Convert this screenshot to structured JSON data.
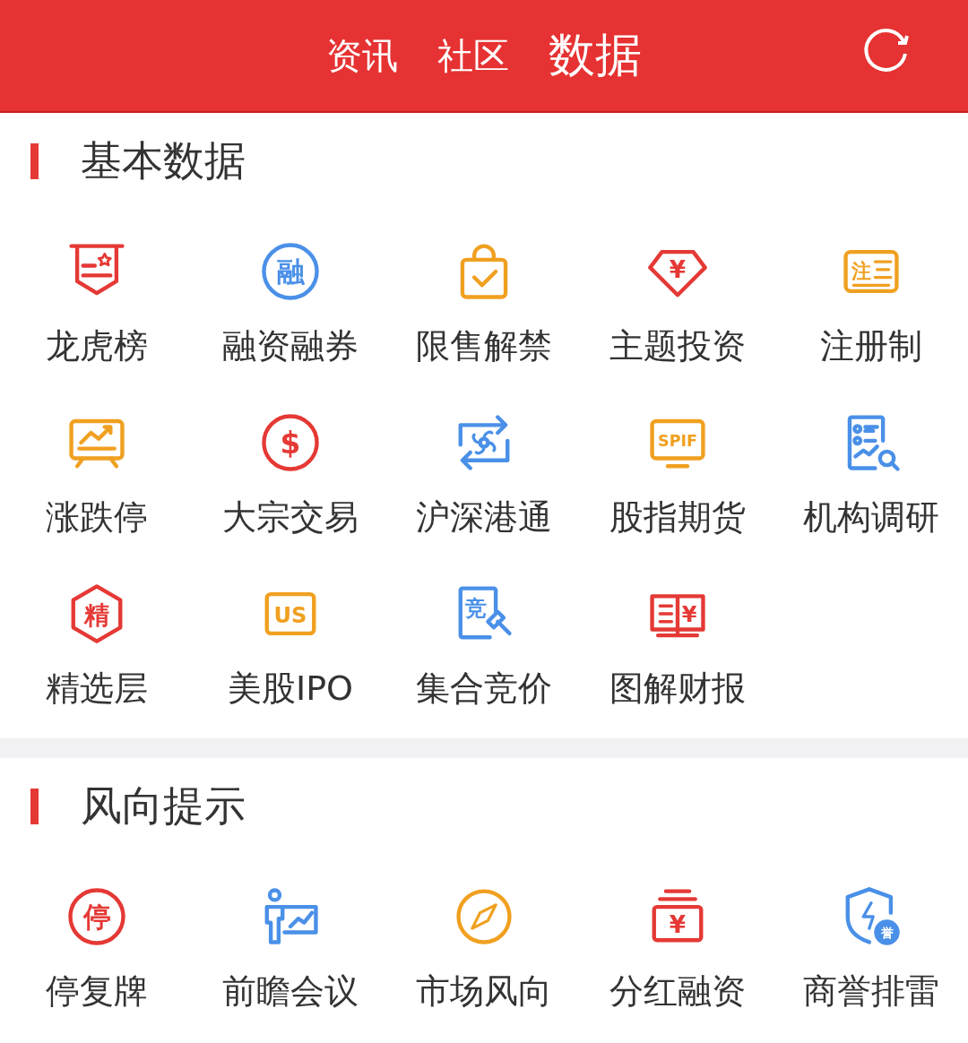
{
  "header": {
    "tabs": [
      {
        "label": "资讯",
        "selected": false
      },
      {
        "label": "社区",
        "selected": false
      },
      {
        "label": "数据",
        "selected": true
      }
    ]
  },
  "sections": [
    {
      "title": "基本数据",
      "items": [
        {
          "label": "龙虎榜",
          "color": "#e53935"
        },
        {
          "label": "融资融券",
          "color": "#4a90e8",
          "glyph": "融"
        },
        {
          "label": "限售解禁",
          "color": "#f0a020"
        },
        {
          "label": "主题投资",
          "color": "#e53935",
          "glyph": "¥"
        },
        {
          "label": "注册制",
          "color": "#f0a020",
          "glyph": "注"
        },
        {
          "label": "涨跌停",
          "color": "#f0a020"
        },
        {
          "label": "大宗交易",
          "color": "#e53935",
          "glyph": "$"
        },
        {
          "label": "沪深港通",
          "color": "#4a90e8"
        },
        {
          "label": "股指期货",
          "color": "#f0a020",
          "glyph": "SPIF"
        },
        {
          "label": "机构调研",
          "color": "#4a90e8"
        },
        {
          "label": "精选层",
          "color": "#e53935",
          "glyph": "精"
        },
        {
          "label": "美股IPO",
          "color": "#f0a020",
          "glyph": "US"
        },
        {
          "label": "集合竞价",
          "color": "#4a90e8",
          "glyph": "竞"
        },
        {
          "label": "图解财报",
          "color": "#e53935",
          "glyph": "¥"
        }
      ]
    },
    {
      "title": "风向提示",
      "items": [
        {
          "label": "停复牌",
          "color": "#e53935",
          "glyph": "停"
        },
        {
          "label": "前瞻会议",
          "color": "#4a90e8"
        },
        {
          "label": "市场风向",
          "color": "#f0a020"
        },
        {
          "label": "分红融资",
          "color": "#e53935",
          "glyph": "¥"
        },
        {
          "label": "商誉排雷",
          "color": "#4a90e8",
          "glyph": "誉"
        }
      ]
    }
  ]
}
